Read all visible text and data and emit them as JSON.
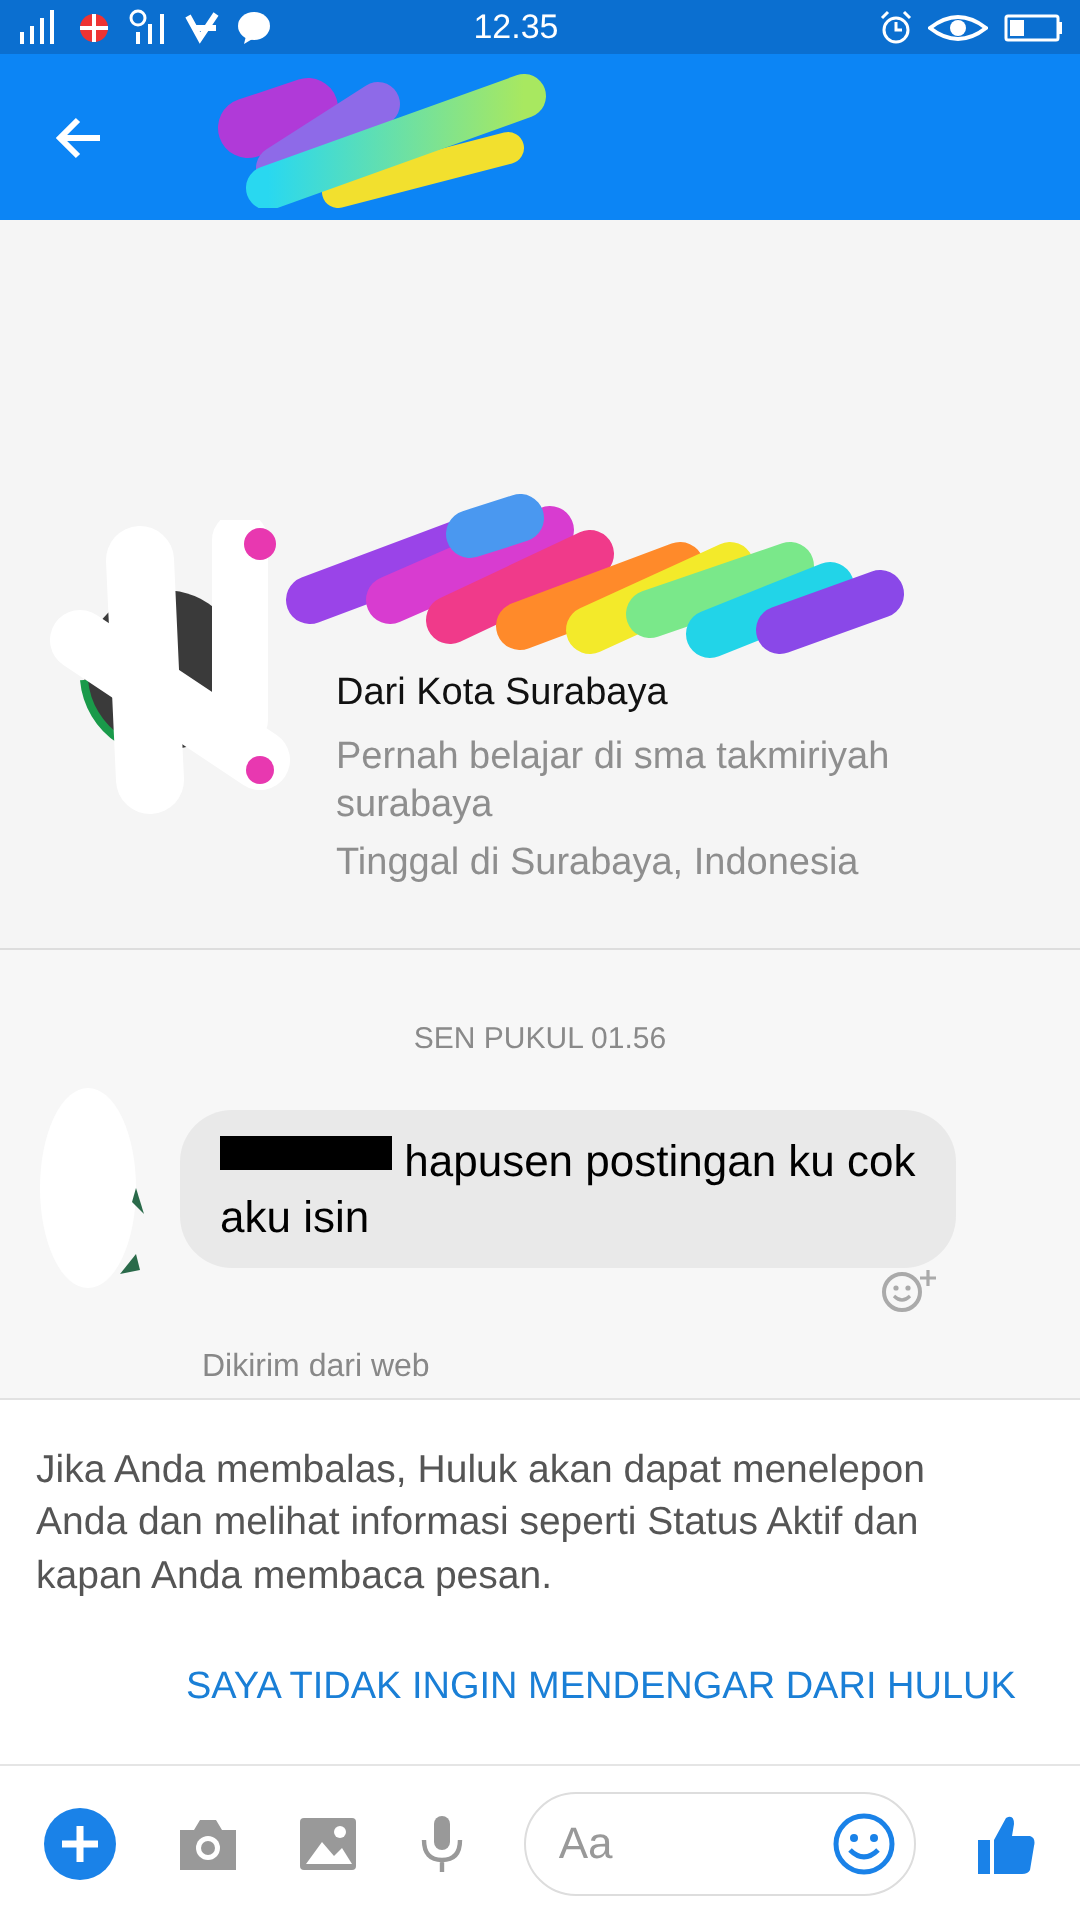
{
  "status_bar": {
    "time": "12.35"
  },
  "header": {
    "title_redacted": true
  },
  "profile": {
    "name_redacted": true,
    "lines": [
      {
        "text": "Dari Kota Surabaya",
        "kind": "primary"
      },
      {
        "text": "Pernah belajar di sma takmiriyah surabaya",
        "kind": "secondary"
      },
      {
        "text": "Tinggal di Surabaya, Indonesia",
        "kind": "secondary"
      }
    ]
  },
  "timestamp": "SEN PUKUL 01.56",
  "message": {
    "text": "hapusen postingan ku cok aku isin",
    "redacted_prefix": true
  },
  "sent_via": "Dikirim dari web",
  "notice": "Jika Anda membalas, Huluk akan dapat menelepon Anda dan melihat informasi seperti Status Aktif dan kapan Anda membaca pesan.",
  "block_link": "SAYA TIDAK INGIN MENDENGAR DARI HULUK",
  "composer": {
    "placeholder": "Aa"
  }
}
